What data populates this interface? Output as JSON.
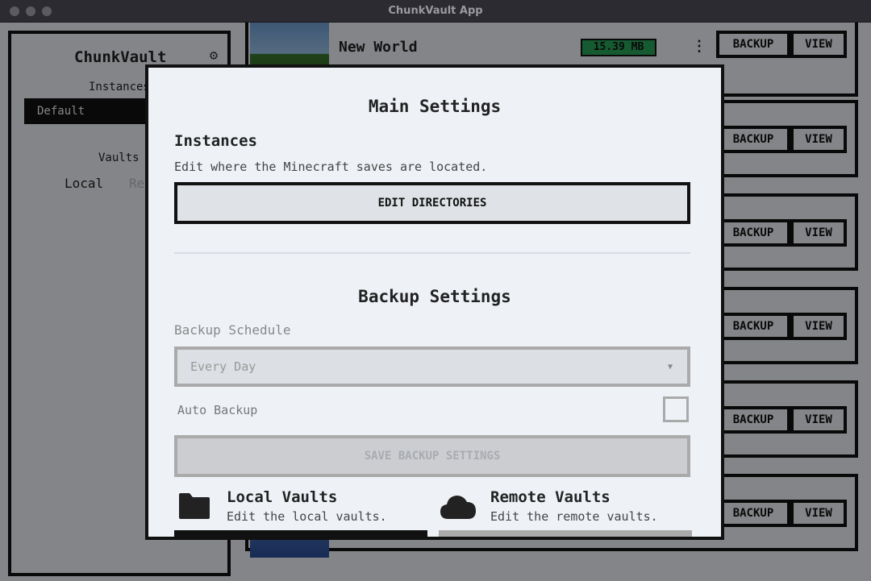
{
  "window": {
    "title": "ChunkVault App"
  },
  "sidebar": {
    "title": "ChunkVault",
    "instances_label": "Instances",
    "instances": [
      "Default"
    ],
    "vaults_label": "Vaults",
    "vault_tabs": [
      "Local",
      "Re"
    ]
  },
  "worlds": [
    {
      "name": "New World",
      "size": "15.39 MB",
      "backup_label": "BACKUP",
      "view_label": "VIEW"
    },
    {
      "backup_label": "BACKUP",
      "view_label": "VIEW"
    },
    {
      "backup_label": "BACKUP",
      "view_label": "VIEW"
    },
    {
      "backup_label": "BACKUP",
      "view_label": "VIEW"
    },
    {
      "backup_label": "BACKUP",
      "view_label": "VIEW"
    },
    {
      "backup_label": "BACKUP",
      "view_label": "VIEW"
    }
  ],
  "modal": {
    "title": "Main Settings",
    "instances": {
      "heading": "Instances",
      "description": "Edit where the Minecraft saves are located.",
      "button": "EDIT DIRECTORIES"
    },
    "backup": {
      "heading": "Backup Settings",
      "schedule_label": "Backup Schedule",
      "schedule_value": "Every Day",
      "auto_backup_label": "Auto Backup",
      "auto_backup_checked": false,
      "save_button": "SAVE BACKUP SETTINGS"
    },
    "local_vaults": {
      "title": "Local Vaults",
      "description": "Edit the local vaults."
    },
    "remote_vaults": {
      "title": "Remote Vaults",
      "description": "Edit the remote vaults."
    }
  },
  "colors": {
    "size_badge": "#28a55a",
    "background": "#f0f3f7",
    "border": "#111111"
  },
  "icons": {
    "settings": "gear-icon",
    "local_vaults": "folder-icon",
    "remote_vaults": "cloud-icon",
    "world_menu": "more-vertical-icon",
    "select_caret": "chevron-down-icon"
  }
}
